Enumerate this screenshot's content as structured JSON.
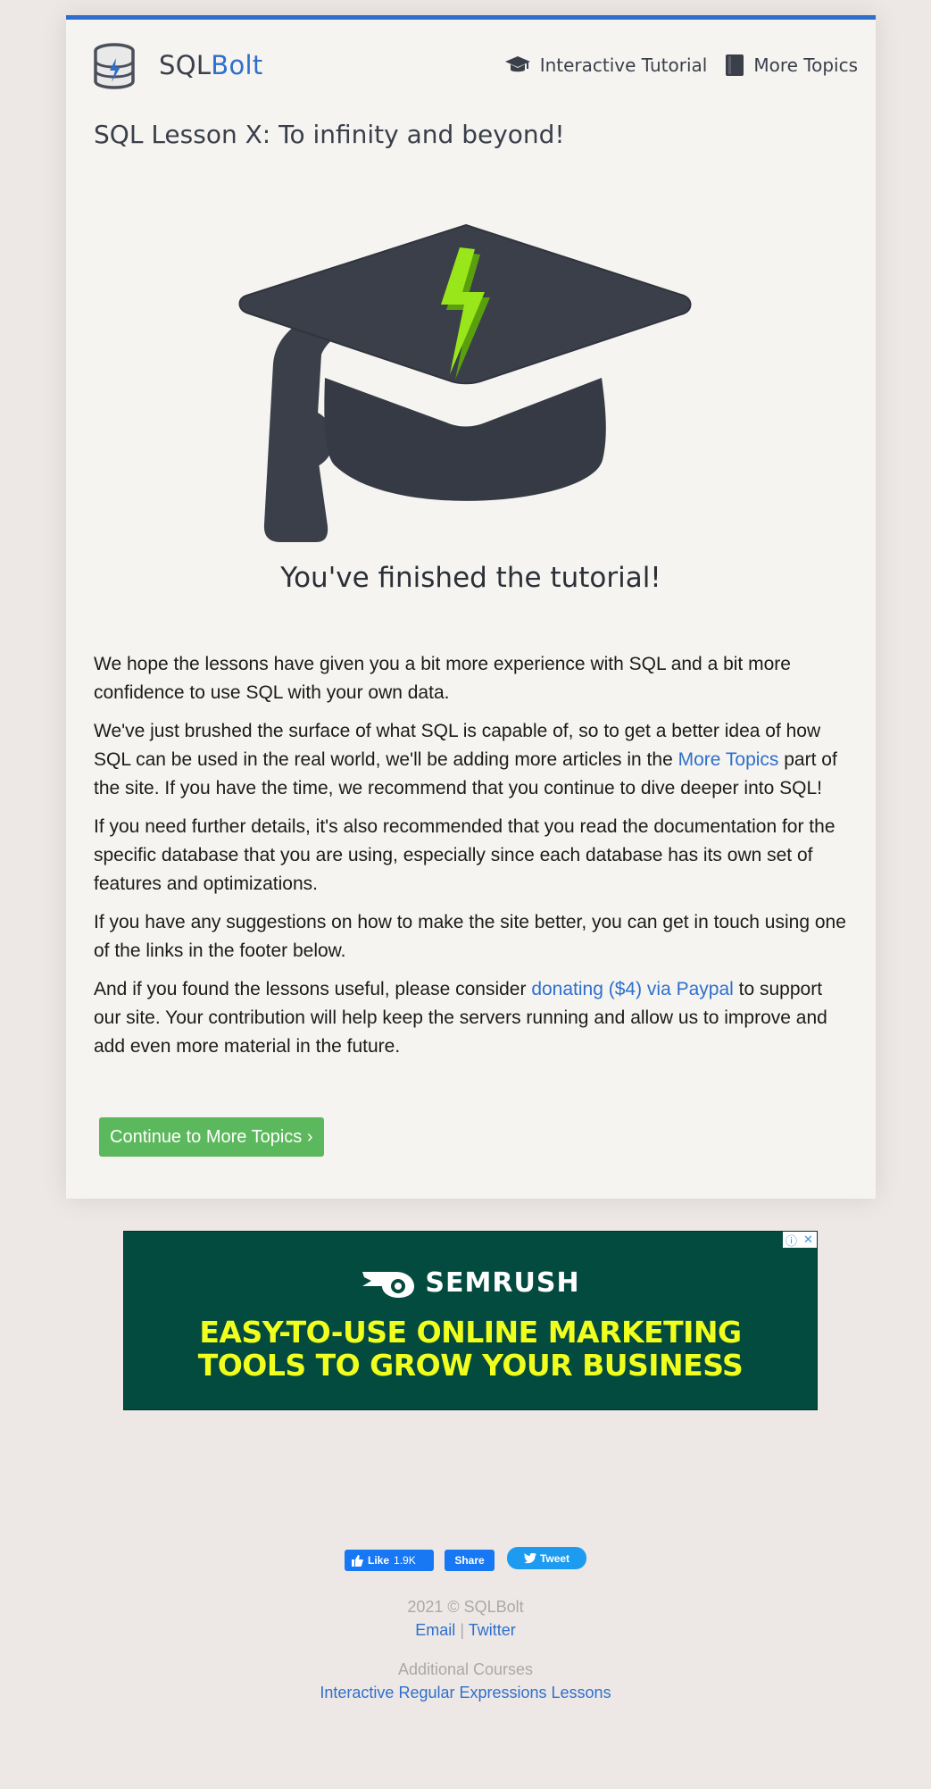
{
  "header": {
    "brand_prefix": "SQL",
    "brand_accent": "Bolt",
    "nav": [
      {
        "label": "Interactive Tutorial",
        "icon": "graduation-cap-icon"
      },
      {
        "label": "More Topics",
        "icon": "book-icon"
      }
    ]
  },
  "lesson": {
    "title": "SQL Lesson X: To infinity and beyond!",
    "finished_text": "You've finished the tutorial!",
    "paragraphs": {
      "p1": "We hope the lessons have given you a bit more experience with SQL and a bit more confidence to use SQL with your own data.",
      "p2_before": "We've just brushed the surface of what SQL is capable of, so to get a better idea of how SQL can be used in the real world, we'll be adding more articles in the ",
      "p2_link": "More Topics",
      "p2_after": " part of the site. If you have the time, we recommend that you continue to dive deeper into SQL!",
      "p3": "If you need further details, it's also recommended that you read the documentation for the specific database that you are using, especially since each database has its own set of features and optimizations.",
      "p4": "If you have any suggestions on how to make the site better, you can get in touch using one of the links in the footer below.",
      "p5_before": "And if you found the lessons useful, please consider ",
      "p5_link": "donating ($4) via Paypal",
      "p5_after": " to support our site. Your contribution will help keep the servers running and allow us to improve and add even more material in the future."
    },
    "cta_label": "Continue to More Topics ›"
  },
  "ad": {
    "brand": "SEMRUSH",
    "headline_line1": "EASY-TO-USE ONLINE MARKETING",
    "headline_line2": "TOOLS TO GROW YOUR BUSINESS",
    "info_glyph": "ⓘ",
    "close_glyph": "✕"
  },
  "social": {
    "like_label": "Like",
    "like_count": "1.9K",
    "share_label": "Share",
    "tweet_label": "Tweet"
  },
  "footer": {
    "copyright": "2021 © SQLBolt",
    "email": "Email",
    "separator": "|",
    "twitter": "Twitter",
    "additional_label": "Additional Courses",
    "regex_link": "Interactive Regular Expressions Lessons"
  },
  "colors": {
    "accent": "#2f6fcb",
    "cta": "#5cb85c",
    "ad_bg": "#034a3f",
    "ad_text": "#f0ff1e"
  }
}
